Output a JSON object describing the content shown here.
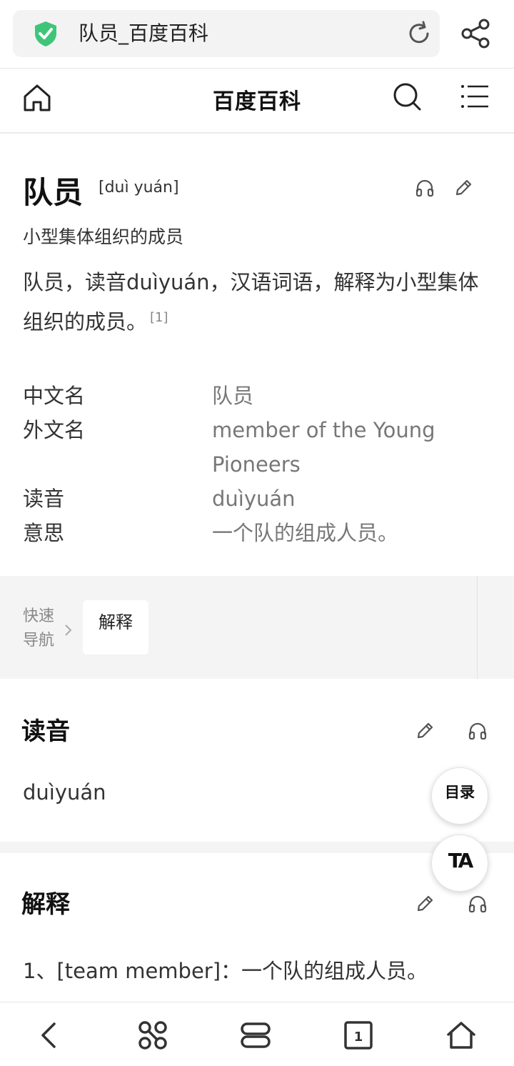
{
  "browser": {
    "tab_title": "队员_百度百科"
  },
  "site": {
    "title": "百度百科"
  },
  "entry": {
    "title": "队员",
    "pinyin": "[duì yuán]",
    "subtitle": "小型集体组织的成员",
    "summary": "队员，读音duìyuán，汉语词语，解释为小型集体组织的成员。",
    "summary_ref": "[1]"
  },
  "infobox": [
    {
      "key": "中文名",
      "value": "队员"
    },
    {
      "key": "外文名",
      "value": "member of the Young Pioneers"
    },
    {
      "key": "读音",
      "value": "duìyuán"
    },
    {
      "key": "意思",
      "value": "一个队的组成人员。"
    }
  ],
  "quicknav": {
    "label": "快速导航",
    "items": [
      "解释"
    ]
  },
  "sections": {
    "pronunciation": {
      "heading": "读音",
      "body": "duìyuán"
    },
    "explanation": {
      "heading": "解释",
      "body": "1、[team member]：一个队的组成人员。"
    }
  },
  "floating": {
    "toc_label": "目录",
    "font_label": "TA"
  },
  "colors": {
    "shield_green": "#3fc57a",
    "text_dark": "#111111",
    "text_muted": "#777777",
    "panel_bg": "#f4f4f4"
  }
}
